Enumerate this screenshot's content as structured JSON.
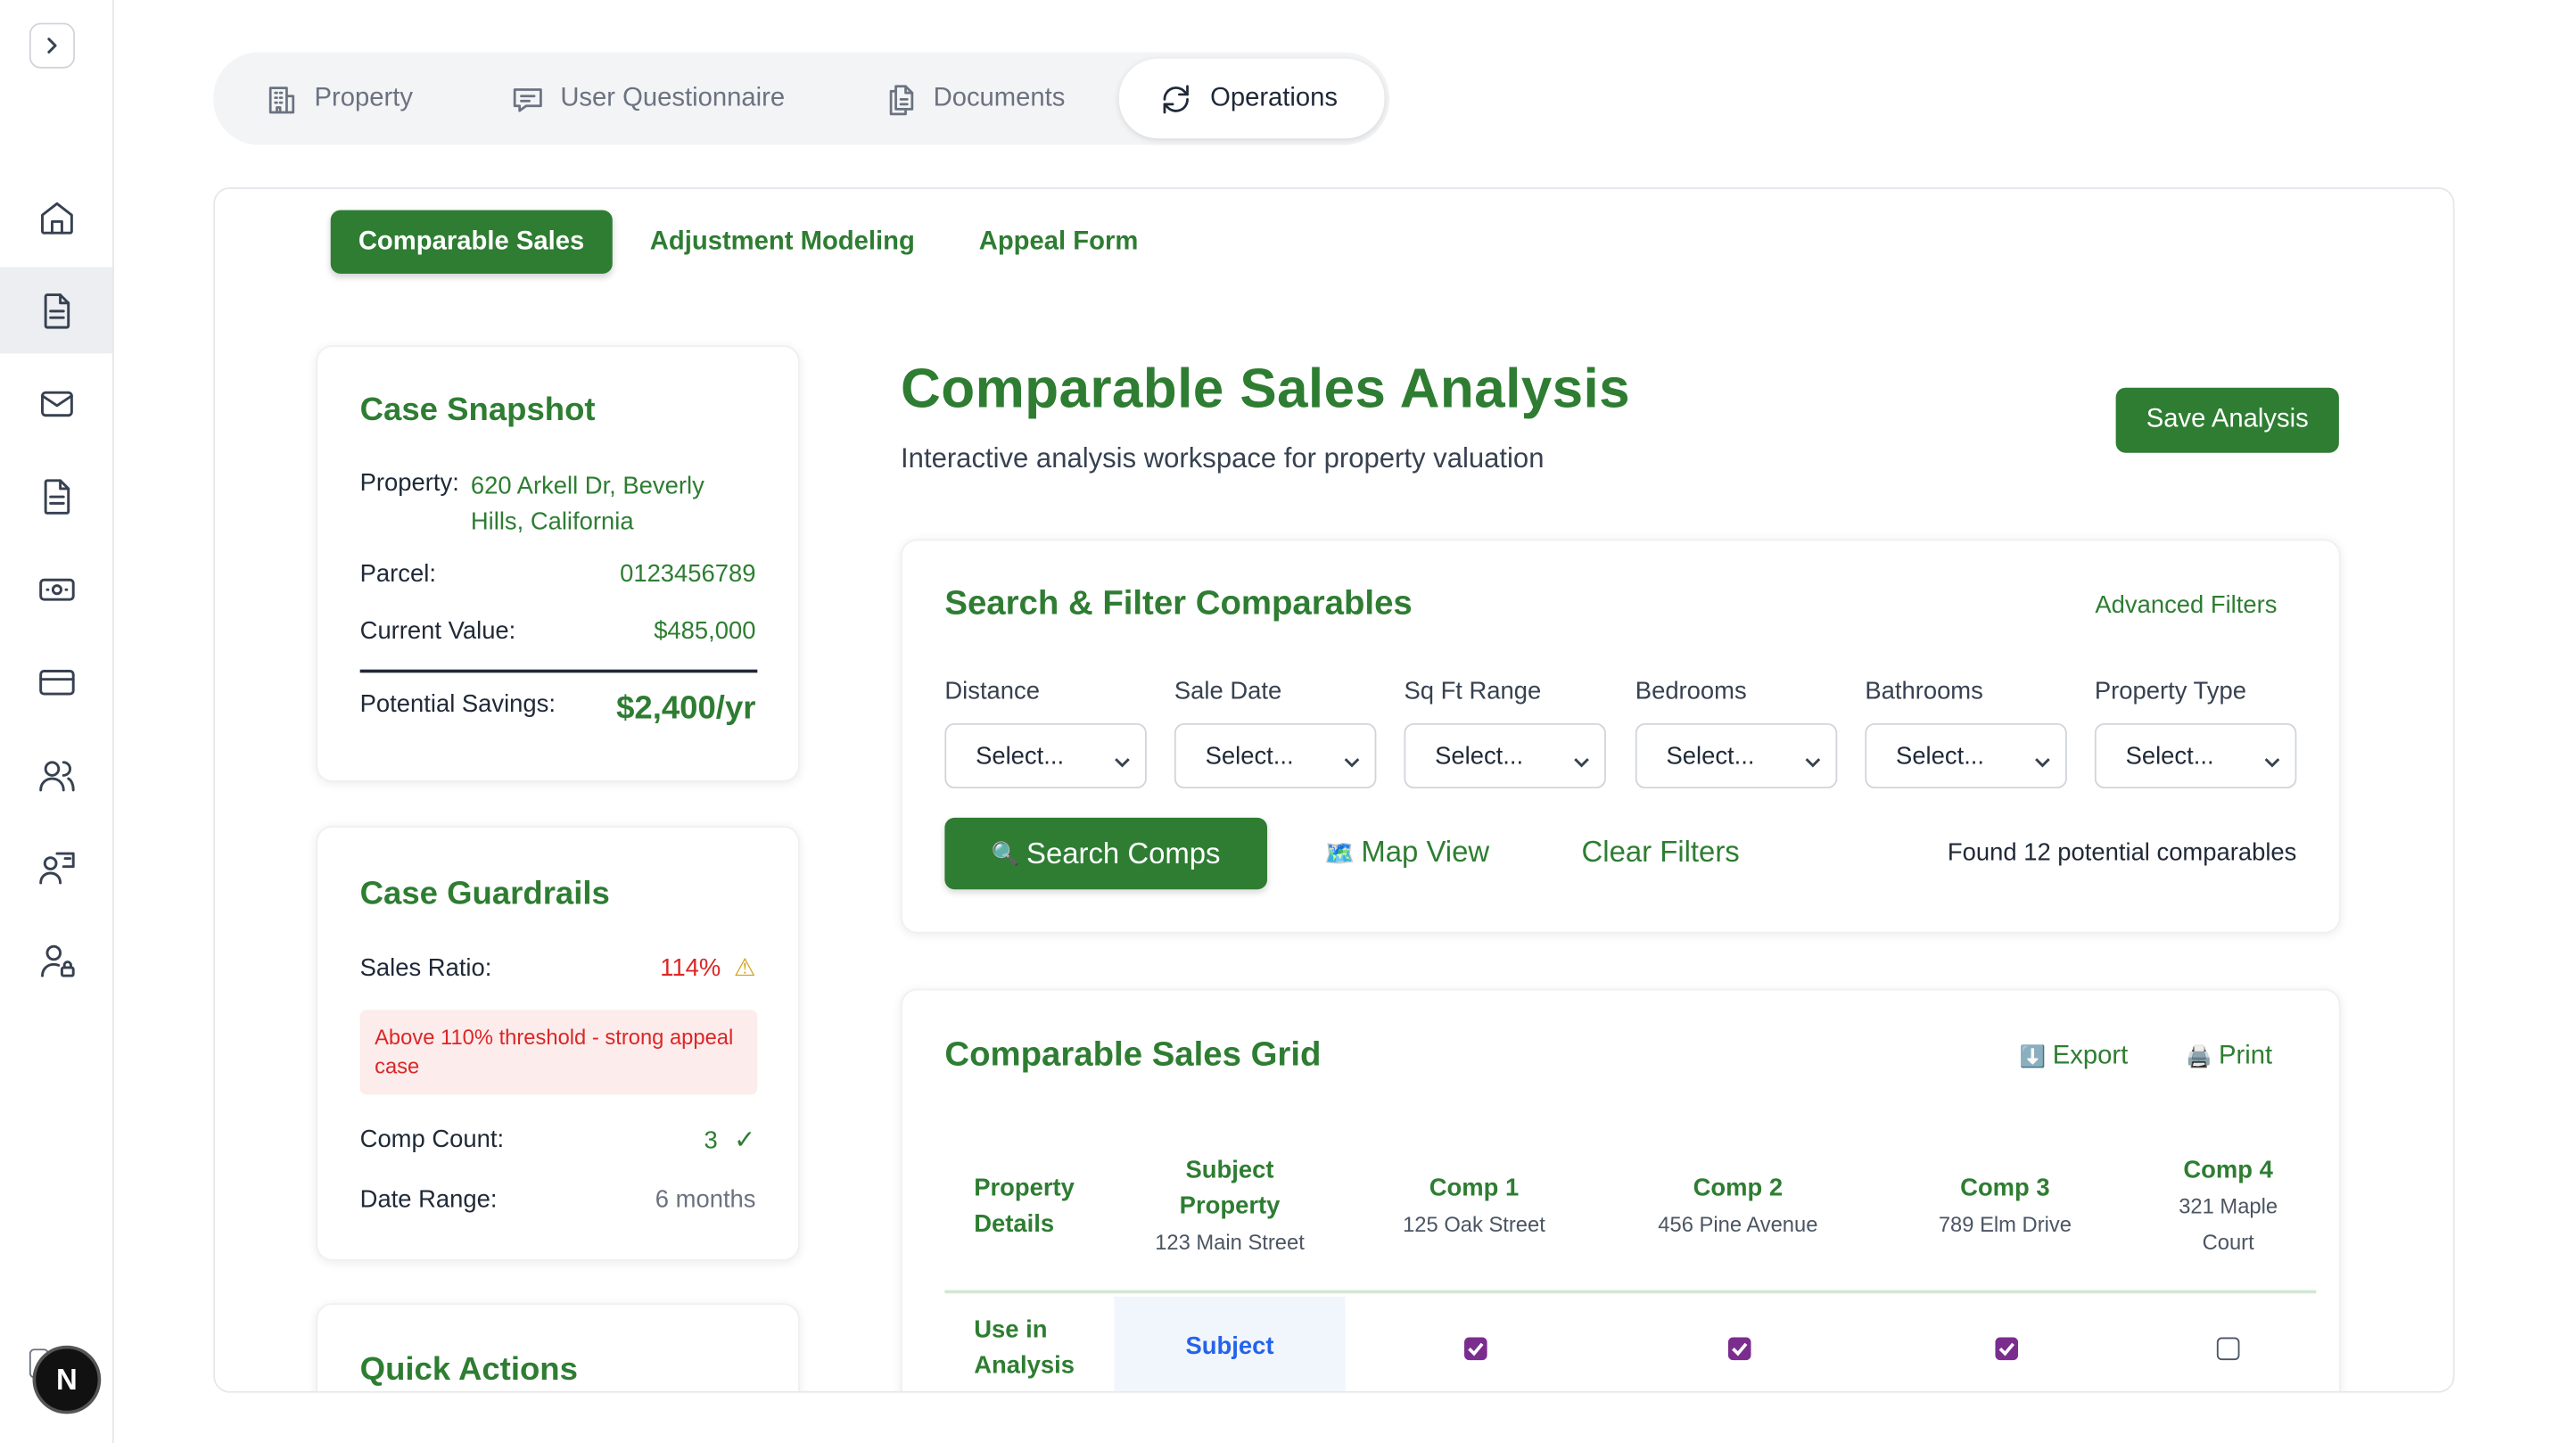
{
  "nav": {
    "items": [
      {
        "name": "home-icon",
        "active": false
      },
      {
        "name": "document-icon",
        "active": true
      },
      {
        "name": "mail-icon",
        "active": false
      },
      {
        "name": "file-icon",
        "active": false
      },
      {
        "name": "money-icon",
        "active": false
      },
      {
        "name": "card-icon",
        "active": false
      },
      {
        "name": "users-icon",
        "active": false
      },
      {
        "name": "presenter-icon",
        "active": false
      },
      {
        "name": "user-lock-icon",
        "active": false
      }
    ],
    "avatar_letter": "N"
  },
  "top_tabs": [
    {
      "label": "Property",
      "icon": "building-icon",
      "active": false
    },
    {
      "label": "User Questionnaire",
      "icon": "chat-icon",
      "active": false
    },
    {
      "label": "Documents",
      "icon": "documents-icon",
      "active": false
    },
    {
      "label": "Operations",
      "icon": "refresh-icon",
      "active": true
    }
  ],
  "sub_tabs": [
    {
      "label": "Comparable Sales",
      "active": true
    },
    {
      "label": "Adjustment Modeling",
      "active": false
    },
    {
      "label": "Appeal Form",
      "active": false
    }
  ],
  "snapshot": {
    "title": "Case Snapshot",
    "property_label": "Property:",
    "property_value": "620 Arkell Dr, Beverly Hills, California",
    "parcel_label": "Parcel:",
    "parcel_value": "0123456789",
    "current_value_label": "Current Value:",
    "current_value": "$485,000",
    "savings_label": "Potential Savings:",
    "savings_value": "$2,400/yr"
  },
  "guardrails": {
    "title": "Case Guardrails",
    "sales_ratio_label": "Sales Ratio:",
    "sales_ratio_value": "114%",
    "warning_icon": "⚠",
    "alert_text": "Above 110% threshold - strong appeal case",
    "comp_count_label": "Comp Count:",
    "comp_count_value": "3",
    "check_icon": "✓",
    "date_range_label": "Date Range:",
    "date_range_value": "6 months"
  },
  "quick_actions": {
    "title": "Quick Actions"
  },
  "analysis": {
    "title": "Comparable Sales Analysis",
    "subtitle": "Interactive analysis workspace for property valuation",
    "save_label": "Save Analysis"
  },
  "filters": {
    "title": "Search & Filter Comparables",
    "advanced_label": "Advanced Filters",
    "fields": [
      {
        "label": "Distance",
        "value": "Select..."
      },
      {
        "label": "Sale Date",
        "value": "Select..."
      },
      {
        "label": "Sq Ft Range",
        "value": "Select..."
      },
      {
        "label": "Bedrooms",
        "value": "Select..."
      },
      {
        "label": "Bathrooms",
        "value": "Select..."
      },
      {
        "label": "Property Type",
        "value": "Select..."
      }
    ],
    "search_icon": "🔍",
    "search_label": "Search Comps",
    "map_icon": "🗺️",
    "map_label": "Map View",
    "clear_label": "Clear Filters",
    "found_text": "Found 12 potential comparables"
  },
  "grid": {
    "title": "Comparable Sales Grid",
    "export_icon": "⬇️",
    "export_label": "Export",
    "print_icon": "🖨️",
    "print_label": "Print",
    "columns": [
      {
        "title": "Property Details",
        "address": ""
      },
      {
        "title": "Subject Property",
        "address": "123 Main Street"
      },
      {
        "title": "Comp 1",
        "address": "125 Oak Street"
      },
      {
        "title": "Comp 2",
        "address": "456 Pine Avenue"
      },
      {
        "title": "Comp 3",
        "address": "789 Elm Drive"
      },
      {
        "title": "Comp 4",
        "address": "321 Maple Court"
      }
    ],
    "row_label": "Use in Analysis",
    "subject_cell": "Subject",
    "checks": [
      true,
      true,
      true,
      false
    ]
  },
  "colors": {
    "accent": "#2e7d32",
    "danger": "#dc2626",
    "checkbox": "#7b2d8e"
  }
}
